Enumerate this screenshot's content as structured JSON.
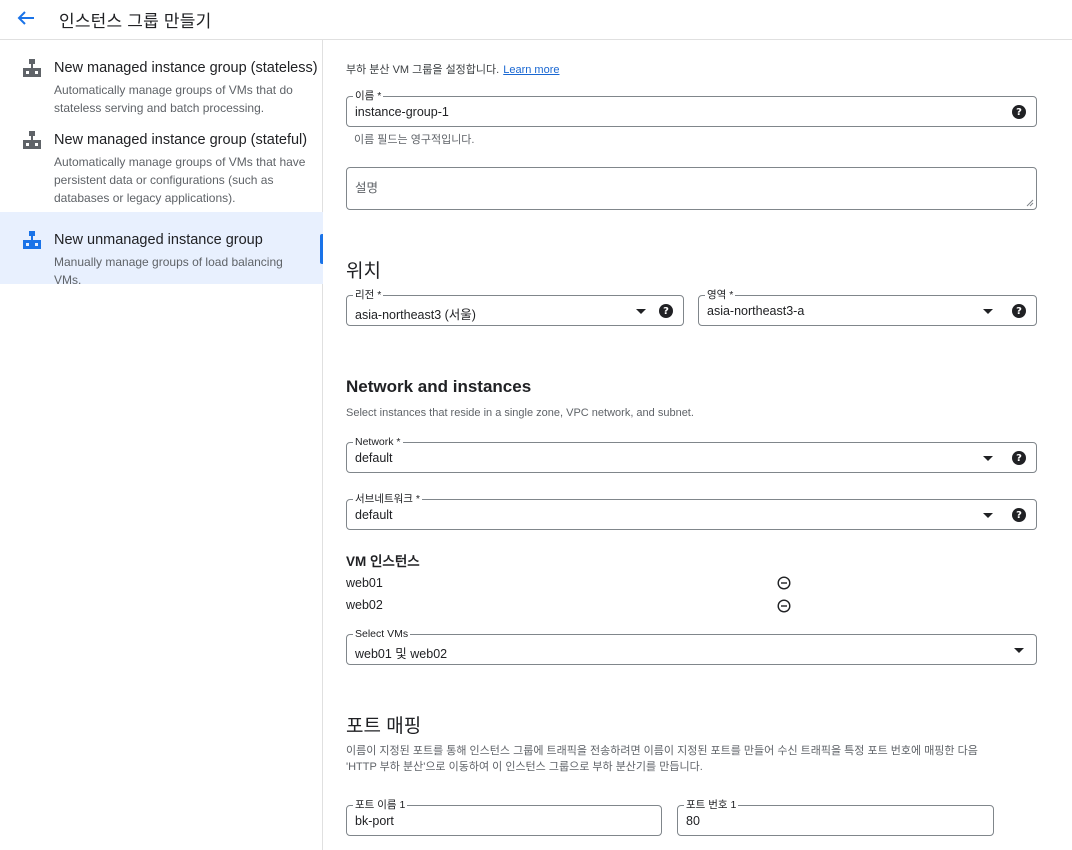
{
  "header": {
    "title": "인스턴스 그룹 만들기",
    "back_icon": "arrow-left-icon"
  },
  "sidebar": {
    "items": [
      {
        "title": "New managed instance group (stateless)",
        "desc": "Automatically manage groups of VMs that do stateless serving and batch processing.",
        "icon": "instance-group-icon",
        "active": false
      },
      {
        "title": "New managed instance group (stateful)",
        "desc": "Automatically manage groups of VMs that have persistent data or configurations (such as databases or legacy applications).",
        "icon": "instance-group-icon",
        "active": false
      },
      {
        "title": "New unmanaged instance group",
        "desc": "Manually manage groups of load balancing VMs.",
        "icon": "instance-group-icon",
        "active": true
      }
    ]
  },
  "form": {
    "intro": "부하 분산 VM 그룹을 설정합니다.",
    "learn_more": "Learn more",
    "name": {
      "label": "이름 *",
      "value": "instance-group-1",
      "hint": "이름 필드는 영구적입니다."
    },
    "description": {
      "placeholder": "설명"
    },
    "location": {
      "heading": "위치",
      "region": {
        "label": "리전 *",
        "value": "asia-northeast3 (서울)"
      },
      "zone": {
        "label": "영역 *",
        "value": "asia-northeast3-a"
      }
    },
    "network_section": {
      "heading": "Network and instances",
      "subtitle": "Select instances that reside in a single zone, VPC network, and subnet.",
      "network": {
        "label": "Network *",
        "value": "default"
      },
      "subnetwork": {
        "label": "서브네트워크 *",
        "value": "default"
      },
      "vm_heading": "VM 인스턴스",
      "vms": [
        "web01",
        "web02"
      ],
      "select_vms": {
        "label": "Select VMs",
        "value": "web01 및 web02"
      }
    },
    "port_mapping": {
      "heading": "포트 매핑",
      "desc_line1": "이름이 지정된 포트를 통해 인스턴스 그룹에 트래픽을 전송하려면 이름이 지정된 포트를 만들어 수신 트래픽을 특정 포트 번호에 매핑한 다음",
      "desc_line2": "'HTTP 부하 분산'으로 이동하여 이 인스턴스 그룹으로 부하 분산기를 만듭니다.",
      "port_name": {
        "label": "포트 이름 1",
        "value": "bk-port"
      },
      "port_number": {
        "label": "포트 번호 1",
        "value": "80"
      }
    }
  },
  "colors": {
    "accent": "#1a73e8",
    "active_bg": "#e8f0fe",
    "border": "#80868b"
  }
}
